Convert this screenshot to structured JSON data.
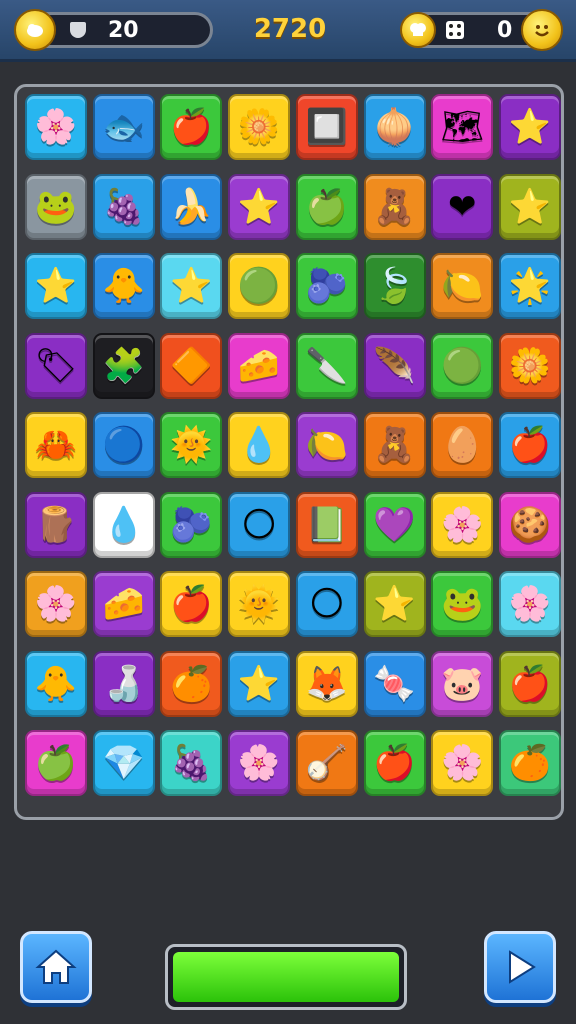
{
  "header": {
    "left_counter": "20",
    "score": "2720",
    "right_counter": "0",
    "icons": [
      "coin-icon",
      "shield-icon",
      "star-score",
      "dice-icon",
      "smiley-coin-icon"
    ]
  },
  "board": {
    "rows": 9,
    "cols": 8,
    "tiles": [
      [
        {
          "bg": "#28b6f0",
          "g": "🌸"
        },
        {
          "bg": "#2a8ee6",
          "g": "🐟"
        },
        {
          "bg": "#3cc83c",
          "g": "🍎"
        },
        {
          "bg": "#ffd21e",
          "g": "🌼"
        },
        {
          "bg": "#f0462a",
          "g": "🔲"
        },
        {
          "bg": "#2aa0e8",
          "g": "🧅"
        },
        {
          "bg": "#e83ccc",
          "g": "🗺"
        },
        {
          "bg": "#8a2ec4",
          "g": "⭐"
        }
      ],
      [
        {
          "bg": "#8a96a0",
          "g": "🐸"
        },
        {
          "bg": "#2aa0e8",
          "g": "🍇"
        },
        {
          "bg": "#2a8ee6",
          "g": "🍌"
        },
        {
          "bg": "#9a3cd0",
          "g": "⭐"
        },
        {
          "bg": "#3cc83c",
          "g": "🍏"
        },
        {
          "bg": "#f08c1e",
          "g": "🧸"
        },
        {
          "bg": "#8a2ec4",
          "g": "❤"
        },
        {
          "bg": "#a0b41e",
          "g": "⭐"
        }
      ],
      [
        {
          "bg": "#28b6f0",
          "g": "⭐"
        },
        {
          "bg": "#2a8ee6",
          "g": "🐥"
        },
        {
          "bg": "#5ad8f0",
          "g": "⭐"
        },
        {
          "bg": "#ffd21e",
          "g": "🟢"
        },
        {
          "bg": "#3cc83c",
          "g": "🫐"
        },
        {
          "bg": "#2e8e2e",
          "g": "🍃"
        },
        {
          "bg": "#f08c1e",
          "g": "🍋"
        },
        {
          "bg": "#2aa0e8",
          "g": "🌟"
        }
      ],
      [
        {
          "bg": "#8a2ec4",
          "g": "🏷"
        },
        {
          "bg": "#1e1e22",
          "g": "🧩"
        },
        {
          "bg": "#f0501e",
          "g": "🔶"
        },
        {
          "bg": "#e83ccc",
          "g": "🧀"
        },
        {
          "bg": "#3cc83c",
          "g": "🔪"
        },
        {
          "bg": "#8a2ec4",
          "g": "🪶"
        },
        {
          "bg": "#3cc83c",
          "g": "🟢"
        },
        {
          "bg": "#f05a1e",
          "g": "🌼"
        }
      ],
      [
        {
          "bg": "#ffd21e",
          "g": "🦀"
        },
        {
          "bg": "#2a8ee6",
          "g": "🔵"
        },
        {
          "bg": "#3cc83c",
          "g": "🌞"
        },
        {
          "bg": "#ffd21e",
          "g": "💧"
        },
        {
          "bg": "#9a3cd0",
          "g": "🍋"
        },
        {
          "bg": "#f07814",
          "g": "🧸"
        },
        {
          "bg": "#f07814",
          "g": "🥚"
        },
        {
          "bg": "#2aa0e8",
          "g": "🍎"
        }
      ],
      [
        {
          "bg": "#8a2ec4",
          "g": "🪵"
        },
        {
          "bg": "#ffffff",
          "g": "💧"
        },
        {
          "bg": "#3cc83c",
          "g": "🫐"
        },
        {
          "bg": "#2aa0e8",
          "g": "🌕"
        },
        {
          "bg": "#f05a1e",
          "g": "📗"
        },
        {
          "bg": "#3cc83c",
          "g": "💜"
        },
        {
          "bg": "#ffd21e",
          "g": "🌸"
        },
        {
          "bg": "#e83ccc",
          "g": "🍪"
        }
      ],
      [
        {
          "bg": "#f0a01e",
          "g": "🌸"
        },
        {
          "bg": "#9a3cd0",
          "g": "🧀"
        },
        {
          "bg": "#ffd21e",
          "g": "🍎"
        },
        {
          "bg": "#ffd21e",
          "g": "🌞"
        },
        {
          "bg": "#2aa0e8",
          "g": "🌕"
        },
        {
          "bg": "#a0b41e",
          "g": "⭐"
        },
        {
          "bg": "#3cc83c",
          "g": "🐸"
        },
        {
          "bg": "#5ad8f0",
          "g": "🌸"
        }
      ],
      [
        {
          "bg": "#28b6f0",
          "g": "🐥"
        },
        {
          "bg": "#8a2ec4",
          "g": "🍶"
        },
        {
          "bg": "#f05a1e",
          "g": "🍊"
        },
        {
          "bg": "#2aa0e8",
          "g": "⭐"
        },
        {
          "bg": "#ffd21e",
          "g": "🦊"
        },
        {
          "bg": "#2a8ee6",
          "g": "🍬"
        },
        {
          "bg": "#c84cd8",
          "g": "🐷"
        },
        {
          "bg": "#a0b41e",
          "g": "🍎"
        }
      ],
      [
        {
          "bg": "#e83ccc",
          "g": "🍏"
        },
        {
          "bg": "#28b6f0",
          "g": "💎"
        },
        {
          "bg": "#3cd4c8",
          "g": "🍇"
        },
        {
          "bg": "#9a3cd0",
          "g": "🌸"
        },
        {
          "bg": "#f07814",
          "g": "🪕"
        },
        {
          "bg": "#3cc83c",
          "g": "🍎"
        },
        {
          "bg": "#ffd21e",
          "g": "🌸"
        },
        {
          "bg": "#3cc87a",
          "g": "🍊"
        }
      ]
    ]
  },
  "controls": {
    "home_icon": "home-icon",
    "play_icon": "play-icon",
    "progress": 1.0
  }
}
